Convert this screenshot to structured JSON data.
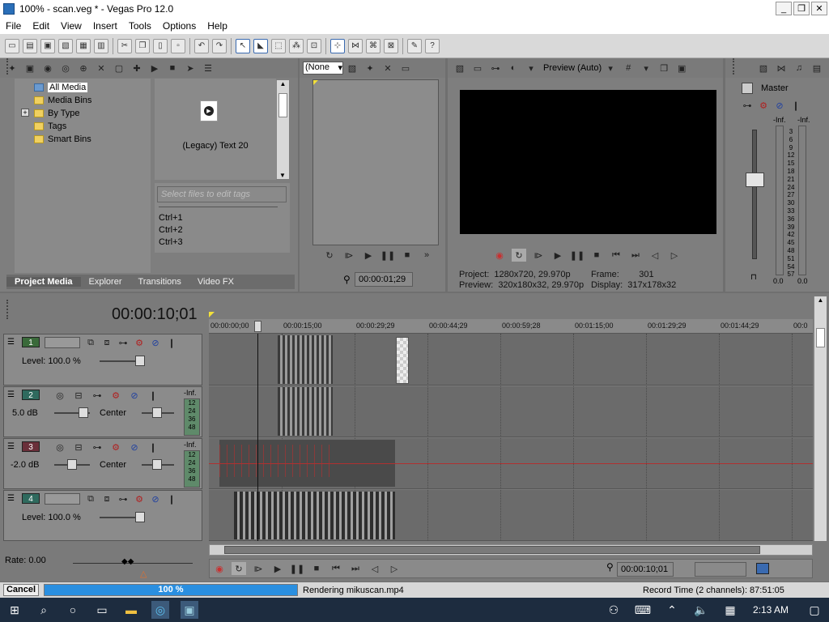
{
  "window": {
    "title": "100% - scan.veg * - Vegas Pro 12.0"
  },
  "menu": [
    "File",
    "Edit",
    "View",
    "Insert",
    "Tools",
    "Options",
    "Help"
  ],
  "explorer": {
    "tree": [
      "All Media",
      "Media Bins",
      "By Type",
      "Tags",
      "Smart Bins"
    ],
    "media_item": "(Legacy) Text 20",
    "tag_placeholder": "Select files to edit tags",
    "shortcuts": [
      "Ctrl+1",
      "Ctrl+2",
      "Ctrl+3"
    ],
    "tabs": [
      "Project Media",
      "Explorer",
      "Transitions",
      "Video FX"
    ]
  },
  "trimmer": {
    "dropdown": "(None",
    "time": "00:00:01;29"
  },
  "preview": {
    "mode": "Preview (Auto)",
    "project_label": "Project:",
    "project_value": "1280x720, 29.970p",
    "preview_label": "Preview:",
    "preview_value": "320x180x32, 29.970p",
    "frame_label": "Frame:",
    "frame_value": "301",
    "display_label": "Display:",
    "display_value": "317x178x32"
  },
  "master": {
    "label": "Master",
    "inf_left": "-Inf.",
    "inf_right": "-Inf.",
    "scale": [
      "3",
      "6",
      "9",
      "12",
      "15",
      "18",
      "21",
      "24",
      "27",
      "30",
      "33",
      "36",
      "39",
      "42",
      "45",
      "48",
      "51",
      "54",
      "57"
    ],
    "bottom_left": "0.0",
    "bottom_right": "0.0"
  },
  "timeline": {
    "current_time": "00:00:10;01",
    "ruler": [
      "00:00:00;00",
      "00:00:15;00",
      "00:00:29;29",
      "00:00:44;29",
      "00:00:59;28",
      "00:01:15;00",
      "00:01:29;29",
      "00:01:44;29",
      "00:0"
    ],
    "tracks": [
      {
        "num": "1",
        "info": "Level: 100.0 %"
      },
      {
        "num": "2",
        "info": "5.0 dB",
        "pan": "Center",
        "inf": "-Inf.",
        "meter": [
          "12",
          "24",
          "36",
          "48"
        ]
      },
      {
        "num": "3",
        "info": "-2.0 dB",
        "pan": "Center",
        "inf": "-Inf.",
        "meter": [
          "12",
          "24",
          "36",
          "48"
        ]
      },
      {
        "num": "4",
        "info": "Level: 100.0 %"
      }
    ],
    "rate": "Rate: 0.00",
    "end_time": "00:00:10;01"
  },
  "status": {
    "cancel": "Cancel",
    "progress_text": "100 %",
    "progress": 1.0,
    "rendering": "Rendering mikuscan.mp4",
    "record": "Record Time (2 channels): 87:51:05"
  },
  "taskbar": {
    "time": "2:13 AM"
  }
}
